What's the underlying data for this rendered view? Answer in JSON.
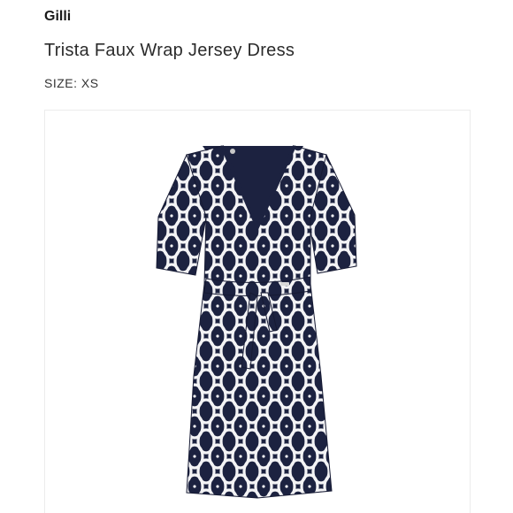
{
  "product": {
    "brand": "Gilli",
    "name": "Trista Faux Wrap Jersey Dress",
    "size_label": "SIZE:",
    "size_value": "XS"
  },
  "image": {
    "subject_icon": "dress-icon",
    "colors": {
      "navy": "#1c2240",
      "pattern": "#f3f3f5",
      "card_border": "#ececec"
    }
  }
}
